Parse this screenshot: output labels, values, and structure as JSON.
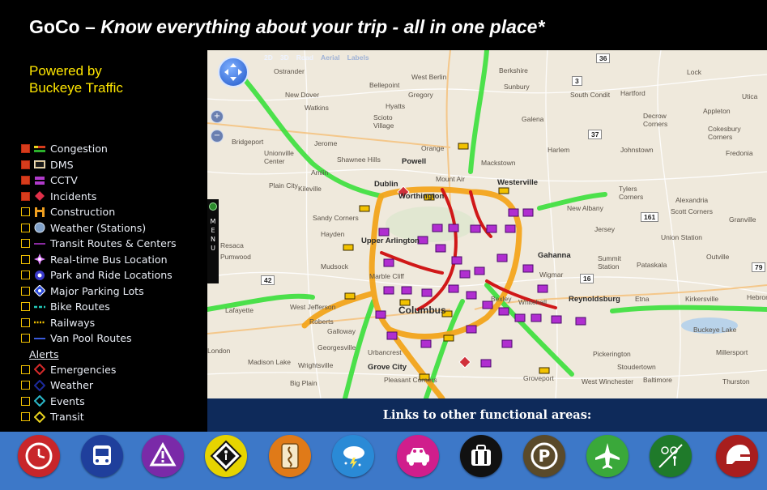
{
  "header": {
    "brand": "GoCo",
    "dash": " – ",
    "tagline": "Know everything about your trip - all in one place*"
  },
  "powered_by": {
    "line1": "Powered by",
    "line2": "Buckeye Traffic"
  },
  "layers": [
    {
      "label": "Congestion",
      "checked": true,
      "icon": "congestion-icon"
    },
    {
      "label": "DMS",
      "checked": true,
      "icon": "dms-sign-icon"
    },
    {
      "label": "CCTV",
      "checked": true,
      "icon": "cctv-icon"
    },
    {
      "label": "Incidents",
      "checked": true,
      "icon": "incident-icon"
    },
    {
      "label": "Construction",
      "checked": false,
      "icon": "construction-icon"
    },
    {
      "label": "Weather (Stations)",
      "checked": false,
      "icon": "weather-station-icon"
    },
    {
      "label": "Transit Routes & Centers",
      "checked": false,
      "icon": "transit-route-icon"
    },
    {
      "label": "Real-time Bus Location",
      "checked": false,
      "icon": "bus-location-icon"
    },
    {
      "label": "Park and Ride Locations",
      "checked": false,
      "icon": "park-and-ride-icon"
    },
    {
      "label": "Major Parking Lots",
      "checked": false,
      "icon": "parking-lot-icon"
    },
    {
      "label": "Bike Routes",
      "checked": false,
      "icon": "bike-route-icon"
    },
    {
      "label": "Railways",
      "checked": false,
      "icon": "railway-icon"
    },
    {
      "label": "Van Pool Routes",
      "checked": false,
      "icon": "van-pool-icon"
    }
  ],
  "alerts": {
    "heading": "Alerts",
    "items": [
      {
        "label": "Emergencies",
        "checked": false,
        "icon": "emergency-alert-icon",
        "color": "#d42a2a"
      },
      {
        "label": "Weather",
        "checked": false,
        "icon": "weather-alert-icon",
        "color": "#1c2a9a"
      },
      {
        "label": "Events",
        "checked": false,
        "icon": "events-alert-icon",
        "color": "#2ab7c8"
      },
      {
        "label": "Transit",
        "checked": false,
        "icon": "transit-alert-icon",
        "color": "#e8d21e"
      }
    ]
  },
  "map": {
    "toolbar": [
      "2D",
      "3D",
      "Road",
      "Aerial",
      "Labels"
    ],
    "menu_letters": "M\nE\nN\nU",
    "route_shields": [
      "36",
      "3",
      "37",
      "161",
      "42",
      "16",
      "79"
    ],
    "labels": {
      "ostrander": "Ostrander",
      "west_berlin": "West Berlin",
      "berkshire": "Berkshire",
      "new_dover": "New Dover",
      "bellepoint": "Bellepoint",
      "gregory": "Gregory",
      "sunbury": "Sunbury",
      "south_condit": "South Condit",
      "hartford": "Hartford",
      "lock": "Lock",
      "utica": "Utica",
      "watkins": "Watkins",
      "hyatts": "Hyatts",
      "scioto_village": "Scioto\nVillage",
      "galena": "Galena",
      "decrow_corners": "Decrow\nCorners",
      "appleton": "Appleton",
      "cokesbury_corners": "Cokesbury\nCorners",
      "bridgeport": "Bridgeport",
      "jerome": "Jerome",
      "orange": "Orange",
      "harlem": "Harlem",
      "johnstown": "Johnstown",
      "fredonia": "Fredonia",
      "unionville_center": "Unionville\nCenter",
      "shawnee_hills": "Shawnee Hills",
      "powell": "Powell",
      "mackstown": "Mackstown",
      "amlin": "Amlin",
      "plain_city": "Plain City",
      "kileville": "Kileville",
      "dublin": "Dublin",
      "worthington": "Worthington",
      "mount_air": "Mount Air",
      "westerville": "Westerville",
      "tylers_corners": "Tylers\nCorners",
      "alexandria": "Alexandria",
      "scott_corners": "Scott Corners",
      "granville": "Granville",
      "sandy_corners": "Sandy Corners",
      "new_albany": "New Albany",
      "hayden": "Hayden",
      "jersey": "Jersey",
      "union_station": "Union Station",
      "resaca": "Resaca",
      "upper_arlington": "Upper Arlington",
      "pumwood": "Pumwood",
      "gahanna": "Gahanna",
      "summit_station": "Summit\nStation",
      "pataskala": "Pataskala",
      "outville": "Outville",
      "mudsock": "Mudsock",
      "marble_cliff": "Marble Cliff",
      "wigmar": "Wigmar",
      "bexley": "Bexley",
      "whitehall": "Whitehall",
      "reynoldsburg": "Reynoldsburg",
      "etna": "Etna",
      "kirkersville": "Kirkersville",
      "hebron": "Hebron",
      "lafayette": "Lafayette",
      "west_jefferson": "West Jefferson",
      "columbus": "Columbus",
      "roberts": "Roberts",
      "galloway": "Galloway",
      "buckeye_lake": "Buckeye Lake",
      "london": "London",
      "georgesville": "Georgesville",
      "urbancrest": "Urbancrest",
      "pickerington": "Pickerington",
      "millersport": "Millersport",
      "madison_lake": "Madison Lake",
      "wrightsville": "Wrightsville",
      "grove_city": "Grove City",
      "stoudertown": "Stoudertown",
      "big_plain": "Big Plain",
      "pleasant_corners": "Pleasant Corners",
      "groveport": "Groveport",
      "west_winchester": "West Winchester",
      "baltimore": "Baltimore",
      "thurston": "Thurston"
    }
  },
  "links_bar": {
    "label": "Links to other functional areas:",
    "icons": [
      {
        "name": "clock-icon",
        "color": "#c8262a"
      },
      {
        "name": "bus-icon",
        "color": "#1f3f9c"
      },
      {
        "name": "warning-icon",
        "color": "#7a2aa8"
      },
      {
        "name": "pedestrian-sign-icon",
        "color": "#e6d400"
      },
      {
        "name": "route-sign-icon",
        "color": "#e07a18"
      },
      {
        "name": "weather-icon",
        "color": "#2a8ad6"
      },
      {
        "name": "carpool-icon",
        "color": "#d01e8c"
      },
      {
        "name": "luggage-icon",
        "color": "#111111"
      },
      {
        "name": "parking-icon",
        "color": "#5a4a2a"
      },
      {
        "name": "airport-icon",
        "color": "#3aa83a"
      },
      {
        "name": "bike-pedestrian-icon",
        "color": "#1f7a2a"
      },
      {
        "name": "helmet-icon",
        "color": "#a81e1e"
      }
    ]
  }
}
